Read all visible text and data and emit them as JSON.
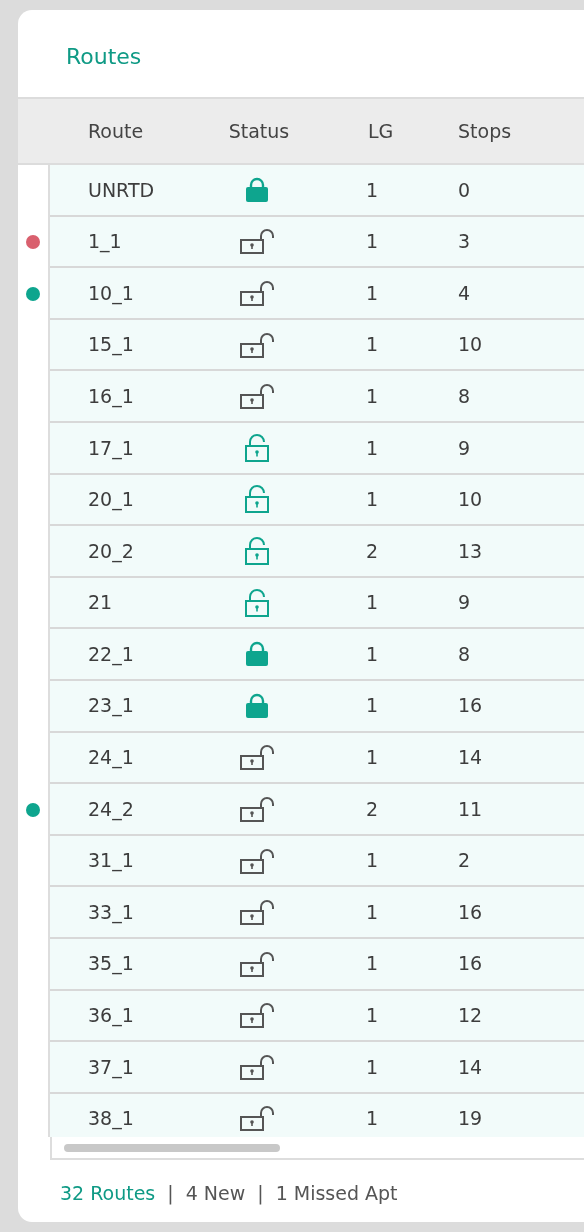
{
  "panel": {
    "title": "Routes"
  },
  "table": {
    "columns": [
      "Route",
      "Status",
      "LG",
      "Stops"
    ],
    "rows": [
      {
        "route": "UNRTD",
        "kind": "locked",
        "lg": "1",
        "stops": "0"
      },
      {
        "route": "1_1",
        "kind": "unlocked",
        "lg": "1",
        "stops": "3",
        "color": "#d9606e"
      },
      {
        "route": "10_1",
        "kind": "unlocked",
        "lg": "1",
        "stops": "4",
        "color": "#0ea58e"
      },
      {
        "route": "15_1",
        "kind": "unlocked",
        "lg": "1",
        "stops": "10"
      },
      {
        "route": "16_1",
        "kind": "unlocked",
        "lg": "1",
        "stops": "8"
      },
      {
        "route": "17_1",
        "kind": "released",
        "lg": "1",
        "stops": "9"
      },
      {
        "route": "20_1",
        "kind": "released",
        "lg": "1",
        "stops": "10"
      },
      {
        "route": "20_2",
        "kind": "released",
        "lg": "2",
        "stops": "13"
      },
      {
        "route": "21",
        "kind": "released",
        "lg": "1",
        "stops": "9"
      },
      {
        "route": "22_1",
        "kind": "locked",
        "lg": "1",
        "stops": "8"
      },
      {
        "route": "23_1",
        "kind": "locked",
        "lg": "1",
        "stops": "16"
      },
      {
        "route": "24_1",
        "kind": "unlocked",
        "lg": "1",
        "stops": "14"
      },
      {
        "route": "24_2",
        "kind": "unlocked",
        "lg": "2",
        "stops": "11",
        "color": "#0ea58e"
      },
      {
        "route": "31_1",
        "kind": "unlocked",
        "lg": "1",
        "stops": "2"
      },
      {
        "route": "33_1",
        "kind": "unlocked",
        "lg": "1",
        "stops": "16"
      },
      {
        "route": "35_1",
        "kind": "unlocked",
        "lg": "1",
        "stops": "16"
      },
      {
        "route": "36_1",
        "kind": "unlocked",
        "lg": "1",
        "stops": "12"
      },
      {
        "route": "37_1",
        "kind": "unlocked",
        "lg": "1",
        "stops": "14"
      },
      {
        "route": "38_1",
        "kind": "unlocked",
        "lg": "1",
        "stops": "19"
      }
    ]
  },
  "footer": {
    "count": "32 Routes",
    "separator_1": "|",
    "new": "4 New",
    "separator_2": "|",
    "missed": "1 Missed Apt"
  }
}
